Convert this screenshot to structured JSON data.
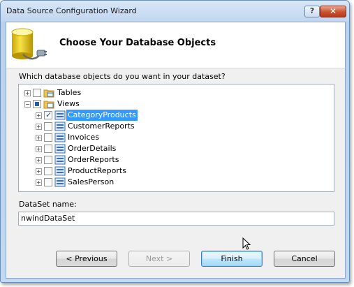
{
  "window": {
    "title": "Data Source Configuration Wizard",
    "help_label": "?",
    "close_label": "✕"
  },
  "header": {
    "title": "Choose Your Database Objects",
    "icon": "database-plug-icon"
  },
  "question": "Which database objects do you want in your dataset?",
  "tree": {
    "roots": [
      {
        "label": "Tables",
        "expanded": false,
        "checked": "unchecked",
        "icon": "tables-folder-icon"
      },
      {
        "label": "Views",
        "expanded": true,
        "checked": "partial",
        "icon": "views-folder-icon"
      }
    ],
    "views": [
      {
        "label": "CategoryProducts",
        "checked": true,
        "selected": true
      },
      {
        "label": "CustomerReports",
        "checked": false,
        "selected": false
      },
      {
        "label": "Invoices",
        "checked": false,
        "selected": false
      },
      {
        "label": "OrderDetails",
        "checked": false,
        "selected": false
      },
      {
        "label": "OrderReports",
        "checked": false,
        "selected": false
      },
      {
        "label": "ProductReports",
        "checked": false,
        "selected": false
      },
      {
        "label": "SalesPerson",
        "checked": false,
        "selected": false
      }
    ]
  },
  "dataset": {
    "label": "DataSet name:",
    "value": "nwindDataSet"
  },
  "buttons": {
    "previous": "< Previous",
    "next": "Next >",
    "finish": "Finish",
    "cancel": "Cancel"
  },
  "colors": {
    "selection": "#3399ff",
    "titlebar": "#c0d6f0",
    "close": "#c9512f"
  }
}
